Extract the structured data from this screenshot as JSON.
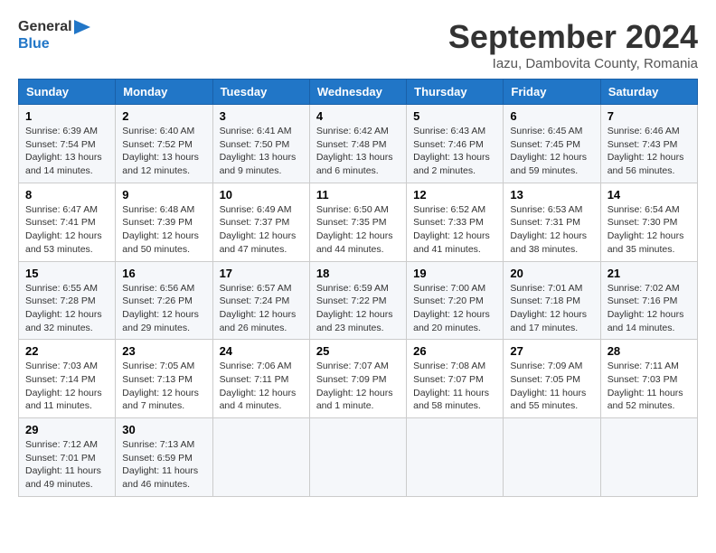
{
  "header": {
    "logo_line1": "General",
    "logo_line2": "Blue",
    "title": "September 2024",
    "subtitle": "Iazu, Dambovita County, Romania"
  },
  "columns": [
    "Sunday",
    "Monday",
    "Tuesday",
    "Wednesday",
    "Thursday",
    "Friday",
    "Saturday"
  ],
  "weeks": [
    [
      {
        "day": "1",
        "lines": [
          "Sunrise: 6:39 AM",
          "Sunset: 7:54 PM",
          "Daylight: 13 hours",
          "and 14 minutes."
        ]
      },
      {
        "day": "2",
        "lines": [
          "Sunrise: 6:40 AM",
          "Sunset: 7:52 PM",
          "Daylight: 13 hours",
          "and 12 minutes."
        ]
      },
      {
        "day": "3",
        "lines": [
          "Sunrise: 6:41 AM",
          "Sunset: 7:50 PM",
          "Daylight: 13 hours",
          "and 9 minutes."
        ]
      },
      {
        "day": "4",
        "lines": [
          "Sunrise: 6:42 AM",
          "Sunset: 7:48 PM",
          "Daylight: 13 hours",
          "and 6 minutes."
        ]
      },
      {
        "day": "5",
        "lines": [
          "Sunrise: 6:43 AM",
          "Sunset: 7:46 PM",
          "Daylight: 13 hours",
          "and 2 minutes."
        ]
      },
      {
        "day": "6",
        "lines": [
          "Sunrise: 6:45 AM",
          "Sunset: 7:45 PM",
          "Daylight: 12 hours",
          "and 59 minutes."
        ]
      },
      {
        "day": "7",
        "lines": [
          "Sunrise: 6:46 AM",
          "Sunset: 7:43 PM",
          "Daylight: 12 hours",
          "and 56 minutes."
        ]
      }
    ],
    [
      {
        "day": "8",
        "lines": [
          "Sunrise: 6:47 AM",
          "Sunset: 7:41 PM",
          "Daylight: 12 hours",
          "and 53 minutes."
        ]
      },
      {
        "day": "9",
        "lines": [
          "Sunrise: 6:48 AM",
          "Sunset: 7:39 PM",
          "Daylight: 12 hours",
          "and 50 minutes."
        ]
      },
      {
        "day": "10",
        "lines": [
          "Sunrise: 6:49 AM",
          "Sunset: 7:37 PM",
          "Daylight: 12 hours",
          "and 47 minutes."
        ]
      },
      {
        "day": "11",
        "lines": [
          "Sunrise: 6:50 AM",
          "Sunset: 7:35 PM",
          "Daylight: 12 hours",
          "and 44 minutes."
        ]
      },
      {
        "day": "12",
        "lines": [
          "Sunrise: 6:52 AM",
          "Sunset: 7:33 PM",
          "Daylight: 12 hours",
          "and 41 minutes."
        ]
      },
      {
        "day": "13",
        "lines": [
          "Sunrise: 6:53 AM",
          "Sunset: 7:31 PM",
          "Daylight: 12 hours",
          "and 38 minutes."
        ]
      },
      {
        "day": "14",
        "lines": [
          "Sunrise: 6:54 AM",
          "Sunset: 7:30 PM",
          "Daylight: 12 hours",
          "and 35 minutes."
        ]
      }
    ],
    [
      {
        "day": "15",
        "lines": [
          "Sunrise: 6:55 AM",
          "Sunset: 7:28 PM",
          "Daylight: 12 hours",
          "and 32 minutes."
        ]
      },
      {
        "day": "16",
        "lines": [
          "Sunrise: 6:56 AM",
          "Sunset: 7:26 PM",
          "Daylight: 12 hours",
          "and 29 minutes."
        ]
      },
      {
        "day": "17",
        "lines": [
          "Sunrise: 6:57 AM",
          "Sunset: 7:24 PM",
          "Daylight: 12 hours",
          "and 26 minutes."
        ]
      },
      {
        "day": "18",
        "lines": [
          "Sunrise: 6:59 AM",
          "Sunset: 7:22 PM",
          "Daylight: 12 hours",
          "and 23 minutes."
        ]
      },
      {
        "day": "19",
        "lines": [
          "Sunrise: 7:00 AM",
          "Sunset: 7:20 PM",
          "Daylight: 12 hours",
          "and 20 minutes."
        ]
      },
      {
        "day": "20",
        "lines": [
          "Sunrise: 7:01 AM",
          "Sunset: 7:18 PM",
          "Daylight: 12 hours",
          "and 17 minutes."
        ]
      },
      {
        "day": "21",
        "lines": [
          "Sunrise: 7:02 AM",
          "Sunset: 7:16 PM",
          "Daylight: 12 hours",
          "and 14 minutes."
        ]
      }
    ],
    [
      {
        "day": "22",
        "lines": [
          "Sunrise: 7:03 AM",
          "Sunset: 7:14 PM",
          "Daylight: 12 hours",
          "and 11 minutes."
        ]
      },
      {
        "day": "23",
        "lines": [
          "Sunrise: 7:05 AM",
          "Sunset: 7:13 PM",
          "Daylight: 12 hours",
          "and 7 minutes."
        ]
      },
      {
        "day": "24",
        "lines": [
          "Sunrise: 7:06 AM",
          "Sunset: 7:11 PM",
          "Daylight: 12 hours",
          "and 4 minutes."
        ]
      },
      {
        "day": "25",
        "lines": [
          "Sunrise: 7:07 AM",
          "Sunset: 7:09 PM",
          "Daylight: 12 hours",
          "and 1 minute."
        ]
      },
      {
        "day": "26",
        "lines": [
          "Sunrise: 7:08 AM",
          "Sunset: 7:07 PM",
          "Daylight: 11 hours",
          "and 58 minutes."
        ]
      },
      {
        "day": "27",
        "lines": [
          "Sunrise: 7:09 AM",
          "Sunset: 7:05 PM",
          "Daylight: 11 hours",
          "and 55 minutes."
        ]
      },
      {
        "day": "28",
        "lines": [
          "Sunrise: 7:11 AM",
          "Sunset: 7:03 PM",
          "Daylight: 11 hours",
          "and 52 minutes."
        ]
      }
    ],
    [
      {
        "day": "29",
        "lines": [
          "Sunrise: 7:12 AM",
          "Sunset: 7:01 PM",
          "Daylight: 11 hours",
          "and 49 minutes."
        ]
      },
      {
        "day": "30",
        "lines": [
          "Sunrise: 7:13 AM",
          "Sunset: 6:59 PM",
          "Daylight: 11 hours",
          "and 46 minutes."
        ]
      },
      {
        "day": "",
        "lines": []
      },
      {
        "day": "",
        "lines": []
      },
      {
        "day": "",
        "lines": []
      },
      {
        "day": "",
        "lines": []
      },
      {
        "day": "",
        "lines": []
      }
    ]
  ]
}
